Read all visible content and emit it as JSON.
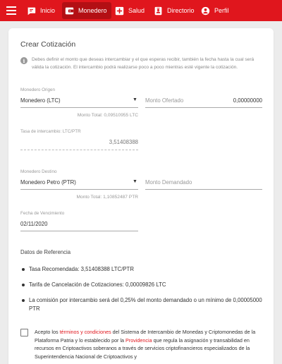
{
  "nav": {
    "items": [
      {
        "label": "Inicio",
        "icon": "chat-icon"
      },
      {
        "label": "Monedero",
        "icon": "wallet-icon"
      },
      {
        "label": "Salud",
        "icon": "medical-cross-icon"
      },
      {
        "label": "Directorio",
        "icon": "contact-card-icon"
      },
      {
        "label": "Perfil",
        "icon": "user-icon"
      }
    ],
    "active": "Monedero",
    "accent_color": "#e0161d"
  },
  "form": {
    "title": "Crear Cotización",
    "info_text": "Debes definir el monto que deseas intercambiar y el que esperas recibir, también la fecha hasta la cual será válida la cotización. El intercambio podrá realizarse poco a poco mientras esté vigente la cotización.",
    "origin": {
      "label": "Monedero Origen",
      "value": "Monedero (LTC)",
      "total": "Monto Total: 0,09510955 LTC"
    },
    "offered": {
      "placeholder": "Monto Ofertado",
      "value": "0,00000000"
    },
    "rate": {
      "label": "Tasa de intercambio: LTC/PTR",
      "value": "3,51408388"
    },
    "destination": {
      "label": "Monedero Destino",
      "value": "Monedero Petro (PTR)",
      "total": "Monto Total: 1,10852487 PTR"
    },
    "demanded": {
      "placeholder": "Monto Demandado"
    },
    "expiry": {
      "label": "Fecha de Vencimiento",
      "value": "02/11/2020"
    }
  },
  "reference": {
    "title": "Datos de Referencia",
    "items": [
      "Tasa Recomendada:  3,51408388 LTC/PTR",
      "Tarifa de Cancelación de Cotizaciones:  0,00009826 LTC",
      "La comisión por intercambio será del 0,25% del monto demandado o un mínimo de 0,00005000 PTR"
    ]
  },
  "terms": {
    "prefix": "Acepto los ",
    "link1": "términos y condiciones",
    "middle": " del Sistema de Intercambio de Monedas y Criptomonedas de la Plataforma Patria y lo establecido por la ",
    "link2": "Providencia",
    "suffix": " que regula la asignación y transabilidad en recursos en Criptoactivos soberanos a través de servicios criptofinancieros especializados de la Superintendencia Nacional de Criptoactivos y"
  }
}
